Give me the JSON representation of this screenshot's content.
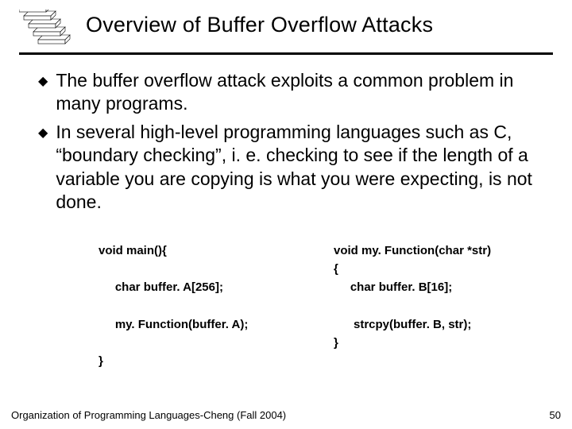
{
  "header": {
    "title": "Overview of Buffer Overflow Attacks"
  },
  "bullets": [
    " The buffer overflow attack exploits a common problem in many programs.",
    " In several high-level programming languages such as C, “boundary checking”, i. e. checking to see if the length of a variable you are copying is what you were expecting, is not done."
  ],
  "code": {
    "left": "void main(){\n\n     char buffer. A[256];\n\n     my. Function(buffer. A);\n\n}",
    "right": "void my. Function(char *str)\n{\n     char buffer. B[16];\n\n      strcpy(buffer. B, str);\n}"
  },
  "footer": {
    "text": "Organization of Programming Languages-Cheng (Fall 2004)",
    "page": "50"
  }
}
